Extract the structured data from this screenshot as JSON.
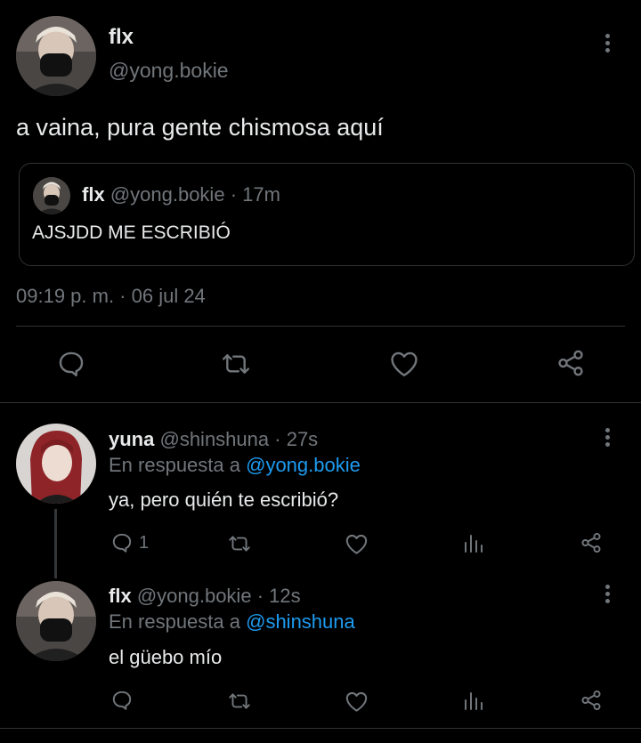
{
  "main_tweet": {
    "display_name": "flx",
    "handle": "@yong.bokie",
    "text": "a vaina, pura gente chismosa aquí",
    "timestamp": "09:19 p. m. · 06 jul 24",
    "quote": {
      "display_name": "flx",
      "handle": "@yong.bokie",
      "sep": "·",
      "time": "17m",
      "text": "AJSJDD ME ESCRIBIÓ"
    }
  },
  "replies": [
    {
      "display_name": "yuna",
      "handle": "@shinshuna",
      "sep": "·",
      "time": "27s",
      "reply_prefix": "En respuesta a",
      "reply_to": "@yong.bokie",
      "text": "ya, pero quién te escribió?",
      "reply_count": "1"
    },
    {
      "display_name": "flx",
      "handle": "@yong.bokie",
      "sep": "·",
      "time": "12s",
      "reply_prefix": "En respuesta a",
      "reply_to": "@shinshuna",
      "text": "el güebo mío",
      "reply_count": ""
    }
  ],
  "icons": [
    "more-icon",
    "reply-icon",
    "retweet-icon",
    "like-icon",
    "views-icon",
    "share-icon"
  ],
  "colors": {
    "background": "#000000",
    "text": "#e7e9ea",
    "muted": "#71767b",
    "link": "#1d9bf0",
    "border": "#2f3336"
  }
}
